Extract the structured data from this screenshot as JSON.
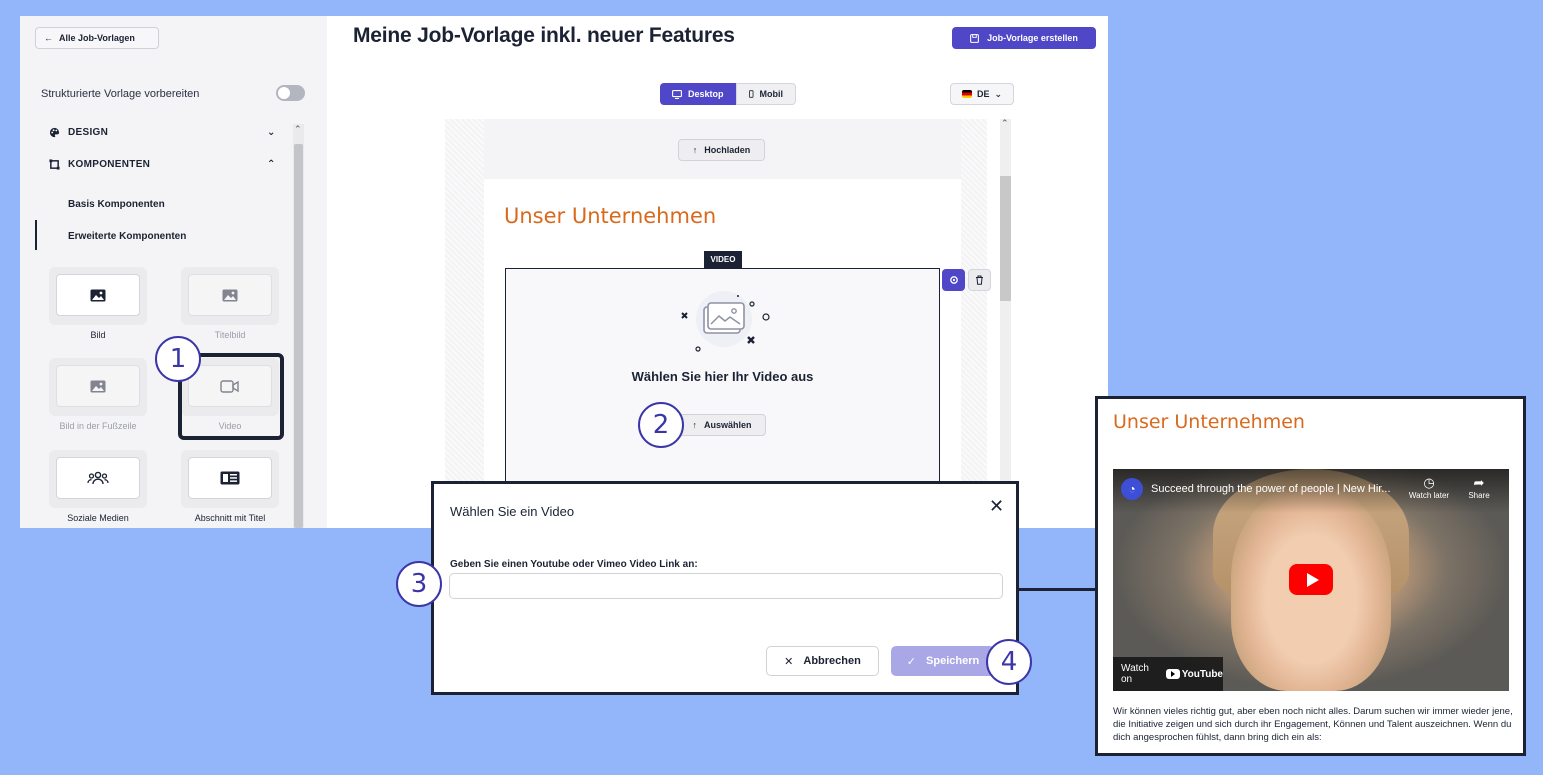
{
  "sidebar": {
    "back_label": "Alle Job-Vorlagen",
    "structured_label": "Strukturierte Vorlage vorbereiten",
    "sections": [
      {
        "label": "DESIGN",
        "icon": "palette-icon",
        "state": "collapsed"
      },
      {
        "label": "KOMPONENTEN",
        "icon": "components-icon",
        "state": "expanded"
      }
    ],
    "sub_items": [
      "Basis Komponenten",
      "Erweiterte Komponenten"
    ],
    "components": [
      {
        "label": "Bild",
        "icon": "image-icon"
      },
      {
        "label": "Titelbild",
        "icon": "image-icon"
      },
      {
        "label": "Bild in der Fußzeile",
        "icon": "image-icon"
      },
      {
        "label": "Video",
        "icon": "video-icon"
      },
      {
        "label": "Soziale Medien",
        "icon": "people-icon"
      },
      {
        "label": "Abschnitt mit Titel",
        "icon": "section-title-icon"
      }
    ]
  },
  "header": {
    "title": "Meine Job-Vorlage inkl. neuer Features",
    "create_label": "Job-Vorlage erstellen"
  },
  "toolbar": {
    "desktop_label": "Desktop",
    "mobile_label": "Mobil",
    "language": "DE"
  },
  "canvas": {
    "upload_label": "Hochladen",
    "section_heading": "Unser Unternehmen",
    "video_tag": "VIDEO",
    "choose_text": "Wählen Sie hier Ihr Video aus",
    "select_label": "Auswählen"
  },
  "modal": {
    "title": "Wählen Sie ein Video",
    "field_label": "Geben Sie einen Youtube oder Vimeo Video Link an:",
    "field_value": "",
    "cancel_label": "Abbrechen",
    "save_label": "Speichern"
  },
  "steps": [
    "1",
    "2",
    "3",
    "4"
  ],
  "preview": {
    "heading": "Unser Unternehmen",
    "video_title": "Succeed through the power of people | New Hir...",
    "watch_later": "Watch later",
    "share": "Share",
    "watch_on": "Watch on",
    "youtube": "YouTube",
    "body": "Wir können vieles richtig gut, aber eben noch nicht alles. Darum suchen wir immer wieder jene, die Initiative zeigen und sich durch ihr Engagement, Können und Talent auszeichnen. Wenn du dich angesprochen fühlst, dann bring dich ein als:"
  },
  "colors": {
    "accent": "#4f46c8",
    "heading_orange": "#d9691c",
    "dark": "#1b2233",
    "background": "#93b5fa"
  }
}
